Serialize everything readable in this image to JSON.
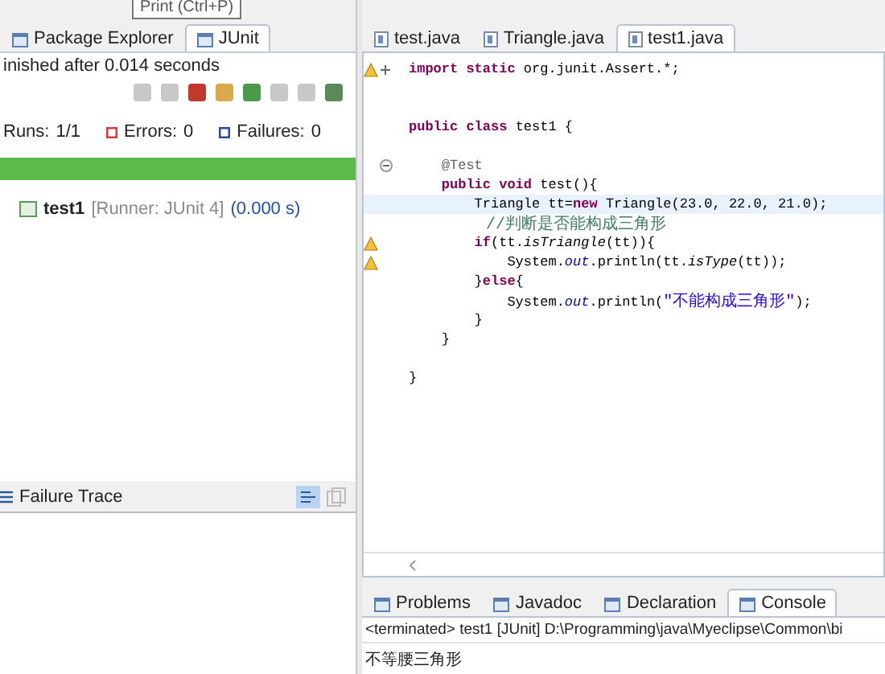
{
  "tooltip": {
    "text": "Print (Ctrl+P)"
  },
  "junit_view": {
    "tabs": [
      {
        "label": "Package Explorer",
        "selected": false
      },
      {
        "label": "JUnit",
        "selected": true
      }
    ],
    "status": "inished after 0.014 seconds",
    "counters": [
      {
        "kind": "runs",
        "label": "Runs:",
        "value": "1/1"
      },
      {
        "kind": "errors",
        "label": "Errors:",
        "value": "0"
      },
      {
        "kind": "failures",
        "label": "Failures:",
        "value": "0"
      }
    ],
    "progress": {
      "level": 1
    },
    "tree": [
      {
        "name": "test1",
        "runner": "[Runner: JUnit 4]",
        "time": "(0.000 s)"
      }
    ],
    "failure_trace": {
      "title": "Failure Trace"
    }
  },
  "editor": {
    "tabs": [
      {
        "label": "test.java",
        "selected": false
      },
      {
        "label": "Triangle.java",
        "selected": false
      },
      {
        "label": "test1.java",
        "selected": true
      }
    ],
    "lines": [
      {
        "warning": true,
        "folded": true,
        "current": false,
        "segments": [
          {
            "kind": "keyword",
            "text": "import static"
          },
          {
            "kind": "plain",
            "text": " org.junit.Assert.*;"
          }
        ]
      },
      {
        "warning": false,
        "current": false
      },
      {
        "warning": false,
        "current": false
      },
      {
        "warning": false,
        "current": false,
        "segments": [
          {
            "kind": "keyword",
            "text": "public class"
          },
          {
            "kind": "plain",
            "text": " test1 {"
          }
        ]
      },
      {
        "warning": false,
        "current": false
      },
      {
        "warning": false,
        "folded": false,
        "current": false,
        "segments": [
          {
            "kind": "annotation",
            "text": "    @Test"
          }
        ]
      },
      {
        "warning": false,
        "current": false,
        "segments": [
          {
            "kind": "keyword",
            "text": "    public void"
          },
          {
            "kind": "plain",
            "text": " test(){"
          }
        ]
      },
      {
        "warning": false,
        "current": true,
        "segments": [
          {
            "kind": "plain",
            "text": "        Triangle tt="
          },
          {
            "kind": "keyword",
            "text": "new"
          },
          {
            "kind": "plain",
            "text": " Triangle(23.0, 22.0, 21.0);"
          }
        ]
      },
      {
        "warning": false,
        "current": false,
        "segments": [
          {
            "kind": "comment",
            "text": "        //判断是否能构成三角形"
          }
        ]
      },
      {
        "warning": true,
        "current": false,
        "segments": [
          {
            "kind": "keyword",
            "text": "        if"
          },
          {
            "kind": "plain",
            "text": "(tt."
          },
          {
            "kind": "italic",
            "text": "isTriangle"
          },
          {
            "kind": "plain",
            "text": "(tt)){"
          }
        ]
      },
      {
        "warning": true,
        "current": false,
        "segments": [
          {
            "kind": "plain",
            "text": "            System."
          },
          {
            "kind": "field",
            "text": "out"
          },
          {
            "kind": "plain",
            "text": ".println(tt."
          },
          {
            "kind": "italic",
            "text": "isType"
          },
          {
            "kind": "plain",
            "text": "(tt));"
          }
        ]
      },
      {
        "warning": false,
        "current": false,
        "segments": [
          {
            "kind": "plain",
            "text": "        }"
          },
          {
            "kind": "keyword",
            "text": "else"
          },
          {
            "kind": "plain",
            "text": "{"
          }
        ]
      },
      {
        "warning": false,
        "current": false,
        "segments": [
          {
            "kind": "plain",
            "text": "            System."
          },
          {
            "kind": "field",
            "text": "out"
          },
          {
            "kind": "plain",
            "text": ".println("
          },
          {
            "kind": "string",
            "text": "\"不能构成三角形\""
          },
          {
            "kind": "plain",
            "text": ");"
          }
        ]
      },
      {
        "warning": false,
        "current": false,
        "segments": [
          {
            "kind": "plain",
            "text": "        }"
          }
        ]
      },
      {
        "warning": false,
        "current": false,
        "segments": [
          {
            "kind": "plain",
            "text": "    }"
          }
        ]
      },
      {
        "warning": false,
        "current": false
      },
      {
        "warning": false,
        "current": false,
        "segments": [
          {
            "kind": "plain",
            "text": "}"
          }
        ]
      }
    ]
  },
  "bottom_panel": {
    "tabs": [
      {
        "label": "Problems",
        "selected": false
      },
      {
        "label": "Javadoc",
        "selected": false
      },
      {
        "label": "Declaration",
        "selected": false
      },
      {
        "label": "Console",
        "selected": true
      }
    ],
    "console_header": "<terminated> test1 [JUnit] D:\\Programming\\java\\Myeclipse\\Common\\bi",
    "output": "不等腰三角形"
  }
}
